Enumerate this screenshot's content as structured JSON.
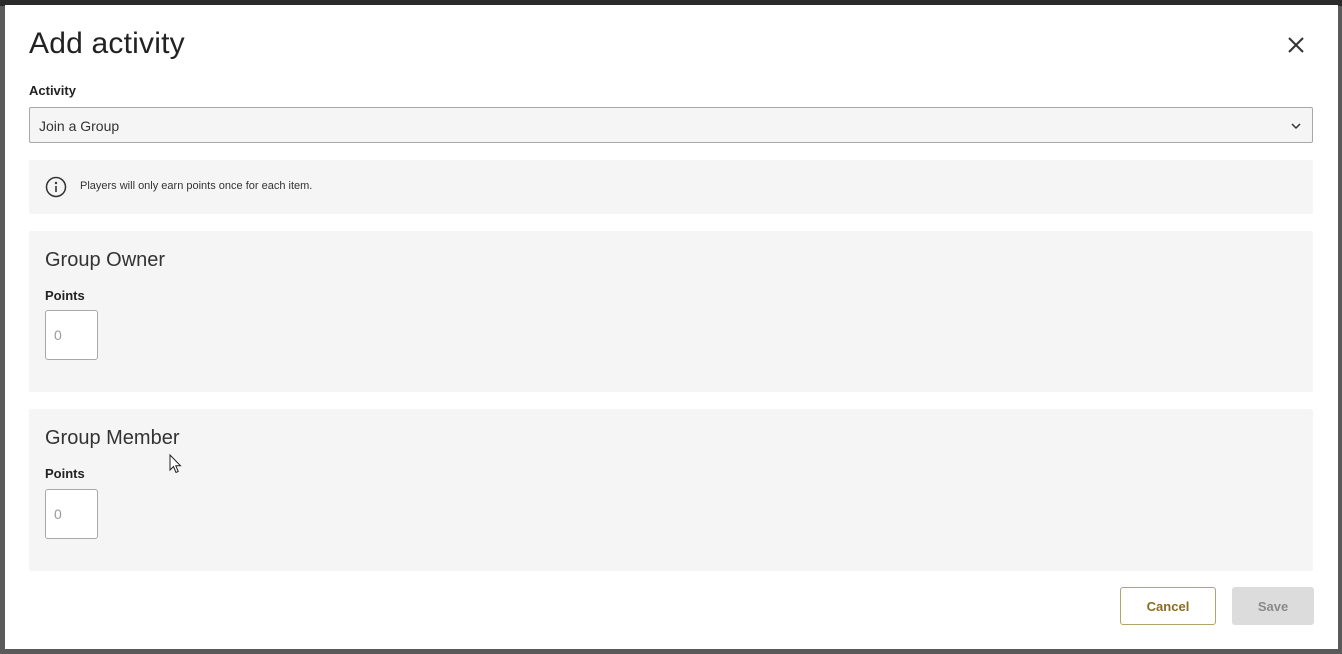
{
  "dialog": {
    "title": "Add activity",
    "close_icon": "close-icon"
  },
  "activity_field": {
    "label": "Activity",
    "selected_value": "Join a Group",
    "chevron_icon": "chevron-down-icon"
  },
  "info": {
    "icon": "info-icon",
    "text": "Players will only earn points once for each item."
  },
  "sections": [
    {
      "title": "Group Owner",
      "points_label": "Points",
      "points_placeholder": "0"
    },
    {
      "title": "Group Member",
      "points_label": "Points",
      "points_placeholder": "0"
    }
  ],
  "footer": {
    "cancel_label": "Cancel",
    "save_label": "Save"
  },
  "colors": {
    "panel_background": "#f5f5f5",
    "cancel_accent": "#8a6d1e",
    "save_disabled": "#dcdcdc"
  }
}
